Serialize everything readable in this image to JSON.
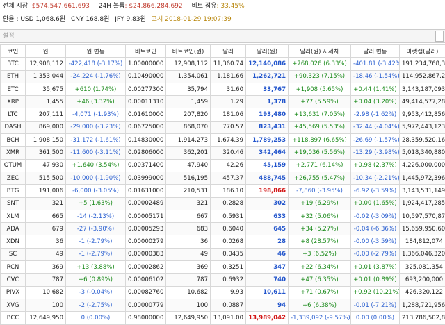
{
  "summary": {
    "market_cap_label": "전체 시장",
    "market_cap_value": ": $574,547,661,693",
    "volume_label": "24H 볼륨",
    "volume_value": ": $24,866,284,692",
    "dominance_label": "비트 점유",
    "dominance_value": ": 33.45%",
    "fx_label": "환율",
    "usd": ": USD 1,068.6원",
    "cny": "CNY 168.8원",
    "jpy": "JPY 9.83원",
    "time": "고시 2018-01-29 19:07:39"
  },
  "settings_label": "설정",
  "columns": [
    "코인",
    "원",
    "원 변동",
    "비트코인",
    "비트코인(원)",
    "달러",
    "달러(원)",
    "달러(원) 시세차",
    "달러 변동",
    "마켓캡(달러)"
  ],
  "rows": [
    {
      "coin": "BTC",
      "krw": "12,908,112",
      "krw_chg": "-422,418 (-3.17%)",
      "krw_dir": "down",
      "btc": "1.00000000",
      "btc_krw": "12,908,112",
      "usd": "11,360.74",
      "usd_krw": "12,140,086",
      "usd_red": false,
      "prem": "+768,026 (6.33%)",
      "prem_dir": "up",
      "usd_chg": "-401.81 (-3.42%)",
      "usd_dir": "down",
      "mcap": "191,234,768,383"
    },
    {
      "coin": "ETH",
      "krw": "1,353,044",
      "krw_chg": "-24,224 (-1.76%)",
      "krw_dir": "down",
      "btc": "0.10490000",
      "btc_krw": "1,354,061",
      "usd": "1,181.66",
      "usd_krw": "1,262,721",
      "usd_red": false,
      "prem": "+90,323 (7.15%)",
      "prem_dir": "up",
      "usd_chg": "-18.46 (-1.54%)",
      "usd_dir": "down",
      "mcap": "114,952,867,201"
    },
    {
      "coin": "ETC",
      "krw": "35,675",
      "krw_chg": "+610 (1.74%)",
      "krw_dir": "up",
      "btc": "0.00277300",
      "btc_krw": "35,794",
      "usd": "31.60",
      "usd_krw": "33,767",
      "usd_red": false,
      "prem": "+1,908 (5.65%)",
      "prem_dir": "up",
      "usd_chg": "+0.44 (1.41%)",
      "usd_dir": "up",
      "mcap": "3,143,187,093"
    },
    {
      "coin": "XRP",
      "krw": "1,455",
      "krw_chg": "+46 (3.32%)",
      "krw_dir": "up",
      "btc": "0.00011310",
      "btc_krw": "1,459",
      "usd": "1.29",
      "usd_krw": "1,378",
      "usd_red": false,
      "prem": "+77 (5.59%)",
      "prem_dir": "up",
      "usd_chg": "+0.04 (3.20%)",
      "usd_dir": "up",
      "mcap": "49,414,577,285"
    },
    {
      "coin": "LTC",
      "krw": "207,111",
      "krw_chg": "-4,071 (-1.93%)",
      "krw_dir": "down",
      "btc": "0.01610000",
      "btc_krw": "207,820",
      "usd": "181.06",
      "usd_krw": "193,480",
      "usd_red": false,
      "prem": "+13,631 (7.05%)",
      "prem_dir": "up",
      "usd_chg": "-2.98 (-1.62%)",
      "usd_dir": "down",
      "mcap": "9,953,412,856"
    },
    {
      "coin": "DASH",
      "krw": "869,000",
      "krw_chg": "-29,000 (-3.23%)",
      "krw_dir": "down",
      "btc": "0.06725000",
      "btc_krw": "868,070",
      "usd": "770.57",
      "usd_krw": "823,431",
      "usd_red": false,
      "prem": "+45,569 (5.53%)",
      "prem_dir": "up",
      "usd_chg": "-32.44 (-4.04%)",
      "usd_dir": "down",
      "mcap": "5,972,443,123"
    },
    {
      "coin": "BCH",
      "krw": "1,908,150",
      "krw_chg": "-31,172 (-1.61%)",
      "krw_dir": "down",
      "btc": "0.14830000",
      "btc_krw": "1,914,273",
      "usd": "1,674.39",
      "usd_krw": "1,789,253",
      "usd_red": false,
      "prem": "+118,897 (6.65%)",
      "prem_dir": "up",
      "usd_chg": "-26.69 (-1.57%)",
      "usd_dir": "down",
      "mcap": "28,359,520,167"
    },
    {
      "coin": "XMR",
      "krw": "361,500",
      "krw_chg": "-11,600 (-3.11%)",
      "krw_dir": "down",
      "btc": "0.02806000",
      "btc_krw": "362,201",
      "usd": "320.46",
      "usd_krw": "342,464",
      "usd_red": false,
      "prem": "+19,036 (5.56%)",
      "prem_dir": "up",
      "usd_chg": "-13.29 (-3.98%)",
      "usd_dir": "down",
      "mcap": "5,018,340,880"
    },
    {
      "coin": "QTUM",
      "krw": "47,930",
      "krw_chg": "+1,640 (3.54%)",
      "krw_dir": "up",
      "btc": "0.00371400",
      "btc_krw": "47,940",
      "usd": "42.26",
      "usd_krw": "45,159",
      "usd_red": false,
      "prem": "+2,771 (6.14%)",
      "prem_dir": "up",
      "usd_chg": "+0.98 (2.37%)",
      "usd_dir": "up",
      "mcap": "4,226,000,000"
    },
    {
      "coin": "ZEC",
      "krw": "515,500",
      "krw_chg": "-10,000 (-1.90%)",
      "krw_dir": "down",
      "btc": "0.03999000",
      "btc_krw": "516,195",
      "usd": "457.37",
      "usd_krw": "488,745",
      "usd_red": false,
      "prem": "+26,755 (5.47%)",
      "prem_dir": "up",
      "usd_chg": "-10.34 (-2.21%)",
      "usd_dir": "down",
      "mcap": "1,445,972,396"
    },
    {
      "coin": "BTG",
      "krw": "191,006",
      "krw_chg": "-6,000 (-3.05%)",
      "krw_dir": "down",
      "btc": "0.01631000",
      "btc_krw": "210,531",
      "usd": "186.10",
      "usd_krw": "198,866",
      "usd_red": true,
      "prem": "-7,860 (-3.95%)",
      "prem_dir": "down",
      "usd_chg": "-6.92 (-3.59%)",
      "usd_dir": "down",
      "mcap": "3,143,531,149"
    },
    {
      "coin": "SNT",
      "krw": "321",
      "krw_chg": "+5 (1.63%)",
      "krw_dir": "up",
      "btc": "0.00002489",
      "btc_krw": "321",
      "usd": "0.2828",
      "usd_krw": "302",
      "usd_red": false,
      "prem": "+19 (6.29%)",
      "prem_dir": "up",
      "usd_chg": "+0.00 (1.65%)",
      "usd_dir": "up",
      "mcap": "1,924,417,285"
    },
    {
      "coin": "XLM",
      "krw": "665",
      "krw_chg": "-14 (-2.13%)",
      "krw_dir": "down",
      "btc": "0.00005171",
      "btc_krw": "667",
      "usd": "0.5931",
      "usd_krw": "633",
      "usd_red": false,
      "prem": "+32 (5.06%)",
      "prem_dir": "up",
      "usd_chg": "-0.02 (-3.09%)",
      "usd_dir": "down",
      "mcap": "10,597,570,870"
    },
    {
      "coin": "ADA",
      "krw": "679",
      "krw_chg": "-27 (-3.90%)",
      "krw_dir": "down",
      "btc": "0.00005293",
      "btc_krw": "683",
      "usd": "0.6040",
      "usd_krw": "645",
      "usd_red": false,
      "prem": "+34 (5.27%)",
      "prem_dir": "up",
      "usd_chg": "-0.04 (-6.36%)",
      "usd_dir": "down",
      "mcap": "15,659,950,604"
    },
    {
      "coin": "XDN",
      "krw": "36",
      "krw_chg": "-1 (-2.79%)",
      "krw_dir": "down",
      "btc": "0.00000279",
      "btc_krw": "36",
      "usd": "0.0268",
      "usd_krw": "28",
      "usd_red": false,
      "prem": "+8 (28.57%)",
      "prem_dir": "up",
      "usd_chg": "-0.00 (-3.59%)",
      "usd_dir": "down",
      "mcap": "184,812,074"
    },
    {
      "coin": "SC",
      "krw": "49",
      "krw_chg": "-1 (-2.79%)",
      "krw_dir": "down",
      "btc": "0.00000383",
      "btc_krw": "49",
      "usd": "0.0435",
      "usd_krw": "46",
      "usd_red": false,
      "prem": "+3 (6.52%)",
      "prem_dir": "up",
      "usd_chg": "-0.00 (-2.79%)",
      "usd_dir": "down",
      "mcap": "1,366,046,320"
    },
    {
      "coin": "RCN",
      "krw": "369",
      "krw_chg": "+13 (3.88%)",
      "krw_dir": "up",
      "btc": "0.00002862",
      "btc_krw": "369",
      "usd": "0.3251",
      "usd_krw": "347",
      "usd_red": false,
      "prem": "+22 (6.34%)",
      "prem_dir": "up",
      "usd_chg": "+0.01 (3.87%)",
      "usd_dir": "up",
      "mcap": "325,081,354"
    },
    {
      "coin": "CVC",
      "krw": "787",
      "krw_chg": "+6 (0.89%)",
      "krw_dir": "up",
      "btc": "0.00006102",
      "btc_krw": "787",
      "usd": "0.6932",
      "usd_krw": "740",
      "usd_red": false,
      "prem": "+47 (6.35%)",
      "prem_dir": "up",
      "usd_chg": "+0.01 (0.89%)",
      "usd_dir": "up",
      "mcap": "693,200,000"
    },
    {
      "coin": "PIVX",
      "krw": "10,682",
      "krw_chg": "-3 (-0.04%)",
      "krw_dir": "down",
      "btc": "0.00082760",
      "btc_krw": "10,682",
      "usd": "9.93",
      "usd_krw": "10,611",
      "usd_red": false,
      "prem": "+71 (0.67%)",
      "prem_dir": "up",
      "usd_chg": "+0.92 (10.21%)",
      "usd_dir": "up",
      "mcap": "426,320,122"
    },
    {
      "coin": "XVG",
      "krw": "100",
      "krw_chg": "-2 (-2.75%)",
      "krw_dir": "down",
      "btc": "0.00000779",
      "btc_krw": "100",
      "usd": "0.0887",
      "usd_krw": "94",
      "usd_red": false,
      "prem": "+6 (6.38%)",
      "prem_dir": "up",
      "usd_chg": "-0.01 (-7.21%)",
      "usd_dir": "down",
      "mcap": "1,288,721,956"
    },
    {
      "coin": "BCC",
      "krw": "12,649,950",
      "krw_chg": "0 (0.00%)",
      "krw_dir": "down",
      "btc": "0.98000000",
      "btc_krw": "12,649,950",
      "usd": "13,091.00",
      "usd_krw": "13,989,042",
      "usd_red": true,
      "prem": "-1,339,092 (-9.57%)",
      "prem_dir": "down",
      "usd_chg": "0.00 (0.00%)",
      "usd_dir": "down",
      "mcap": "213,786,502,800"
    }
  ]
}
